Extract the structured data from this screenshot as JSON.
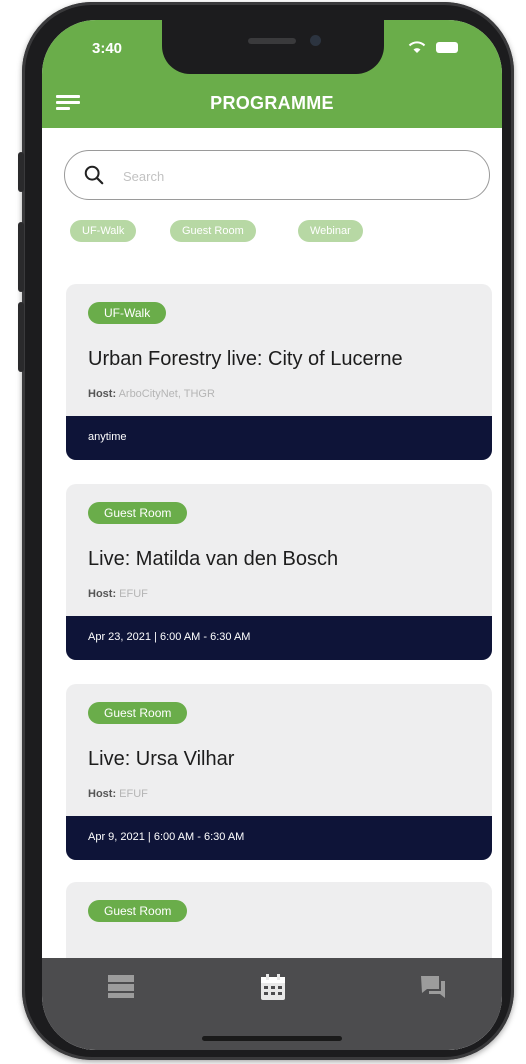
{
  "status_bar": {
    "time": "3:40"
  },
  "header": {
    "title": "PROGRAMME"
  },
  "search": {
    "placeholder": "Search"
  },
  "filters": [
    "UF-Walk",
    "Guest Room",
    "Webinar"
  ],
  "cards": [
    {
      "tag": "UF-Walk",
      "title": "Urban Forestry live: City of Lucerne",
      "host_label": "Host:",
      "host": "ArboCityNet, THGR",
      "time": "anytime"
    },
    {
      "tag": "Guest Room",
      "title": "Live: Matilda van den Bosch",
      "host_label": "Host:",
      "host": "EFUF",
      "time": "Apr 23, 2021 | 6:00 AM - 6:30 AM"
    },
    {
      "tag": "Guest Room",
      "title": "Live: Ursa Vilhar",
      "host_label": "Host:",
      "host": "EFUF",
      "time": "Apr 9, 2021 | 6:00 AM - 6:30 AM"
    },
    {
      "tag": "Guest Room"
    }
  ],
  "tab_bar": {
    "icons": [
      "list-icon",
      "calendar-icon",
      "chat-icon"
    ]
  },
  "colors": {
    "accent": "#6aad4a",
    "chip": "#b7d8a4",
    "dark_bar": "#0e1438",
    "tab_bar": "#4c4c4e",
    "card": "#eeeeef"
  }
}
